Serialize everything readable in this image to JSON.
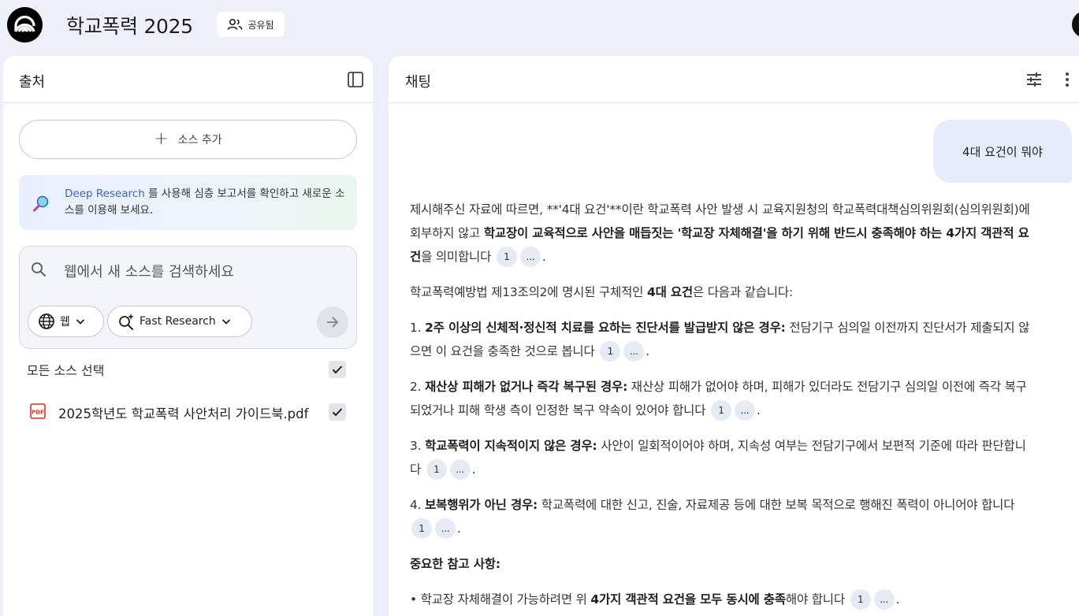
{
  "app": {
    "title": "학교폭력 2025",
    "share_label": "공유됨"
  },
  "sources_panel": {
    "title": "출처",
    "add_source_label": "소스 추가",
    "deep_research": {
      "link_text": "Deep Research",
      "text": " 를 사용해 심층 보고서를 확인하고 새로운 소스를 이용해 보세요."
    },
    "search": {
      "placeholder": "웹에서 새 소스를 검색하세요",
      "source_type": "웹",
      "research_mode": "Fast Research"
    },
    "select_all_label": "모든 소스 선택",
    "files": [
      {
        "name": "2025학년도 학교폭력 사안처리 가이드북.pdf",
        "checked": true
      }
    ]
  },
  "chat_panel": {
    "title": "채팅",
    "user_message": "4대 요건이 뭐야",
    "citations": {
      "first": "1",
      "more": "..."
    },
    "answer": {
      "p1_a": "제시해주신 자료에 따르면, **'4대 요건'**이란 학교폭력 사안 발생 시 교육지원청의 학교폭력대책심의위원회(심의위원회)에 회부하지 않고 ",
      "p1_b": "학교장이 교육적으로 사안을 매듭짓는 '학교장 자체해결'을 하기 위해 반드시 충족해야 하는 4가지 객관적 요건",
      "p1_c": "을 의미합니다",
      "p2_a": "학교폭력예방법 제13조의2에 명시된 구체적인 ",
      "p2_b": "4대 요건",
      "p2_c": "은 다음과 같습니다:",
      "items": [
        {
          "num": "1. ",
          "bold": "2주 이상의 신체적·정신적 치료를 요하는 진단서를 발급받지 않은 경우:",
          "text": " 전담기구 심의일 이전까지 진단서가 제출되지 않으면 이 요건을 충족한 것으로 봅니다"
        },
        {
          "num": "2. ",
          "bold": "재산상 피해가 없거나 즉각 복구된 경우:",
          "text": " 재산상 피해가 없어야 하며, 피해가 있더라도 전담기구 심의일 이전에 즉각 복구되었거나 피해 학생 측이 인정한 복구 약속이 있어야 합니다"
        },
        {
          "num": "3. ",
          "bold": "학교폭력이 지속적이지 않은 경우:",
          "text": " 사안이 일회적이어야 하며, 지속성 여부는 전담기구에서 보편적 기준에 따라 판단합니다"
        },
        {
          "num": "4. ",
          "bold": "보복행위가 아닌 경우:",
          "text": " 학교폭력에 대한 신고, 진술, 자료제공 등에 대한 보복 목적으로 행해진 폭력이 아니어야 합니다"
        }
      ],
      "note_heading": "중요한 참고 사항:",
      "note_a": "• 학교장 자체해결이 가능하려면 위 ",
      "note_b": "4가지 객관적 요건을 모두 동시에 충족",
      "note_c": "해야 합니다"
    }
  }
}
